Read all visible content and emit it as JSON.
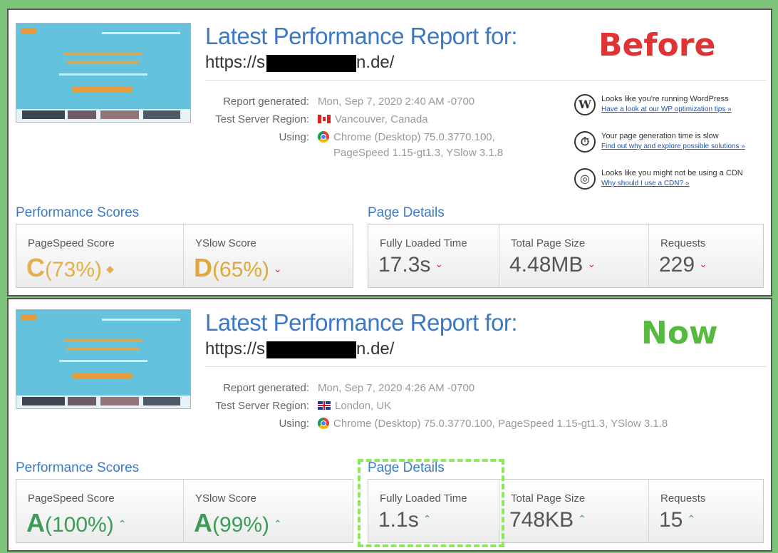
{
  "colors": {
    "background": "#7dc47a",
    "title": "#3d79c2",
    "before_badge": "#e03434",
    "now_badge": "#55bb3f",
    "grade_c": "#e3b04a",
    "grade_d": "#e0a83a",
    "grade_a": "#3a9d57",
    "down_arrow": "#d62d3b",
    "up_arrow": "#3a9d57",
    "highlight_border": "#8ee85d"
  },
  "reports": [
    {
      "badge": "Before",
      "title": "Latest Performance Report for:",
      "url_prefix": "https://s",
      "url_suffix": "n.de/",
      "report_generated_label": "Report generated:",
      "report_generated_value": "Mon, Sep 7, 2020 2:40 AM -0700",
      "region_label": "Test Server Region:",
      "region_value": "Vancouver, Canada",
      "region_flag": "canada-flag-icon",
      "using_label": "Using:",
      "using_value_1": "Chrome (Desktop) 75.0.3770.100,",
      "using_value_2": "PageSpeed 1.15-gt1.3, YSlow 3.1.8",
      "tips": [
        {
          "icon": "wordpress-icon",
          "glyph": "W",
          "text": "Looks like you're running WordPress",
          "link": "Have a look at our WP optimization tips »"
        },
        {
          "icon": "stopwatch-icon",
          "glyph": "⏱",
          "text": "Your page generation time is slow",
          "link": "Find out why and explore possible solutions »"
        },
        {
          "icon": "globe-icon",
          "glyph": "◎",
          "text": "Looks like you might not be using a CDN",
          "link": "Why should I use a CDN? »"
        }
      ],
      "performance_title": "Performance Scores",
      "page_details_title": "Page Details",
      "pagespeed_label": "PageSpeed Score",
      "pagespeed_grade": "C",
      "pagespeed_value": "(73%)",
      "pagespeed_arrow": "◆",
      "yslow_label": "YSlow Score",
      "yslow_grade": "D",
      "yslow_value": "(65%)",
      "yslow_arrow": "⌄",
      "fully_loaded_label": "Fully Loaded Time",
      "fully_loaded_value": "17.3s",
      "page_size_label": "Total Page Size",
      "page_size_value": "4.48MB",
      "requests_label": "Requests",
      "requests_value": "229",
      "detail_arrow": "⌄"
    },
    {
      "badge": "Now",
      "title": "Latest Performance Report for:",
      "url_prefix": "https://s",
      "url_suffix": "n.de/",
      "report_generated_label": "Report generated:",
      "report_generated_value": "Mon, Sep 7, 2020 4:26 AM -0700",
      "region_label": "Test Server Region:",
      "region_value": "London, UK",
      "region_flag": "uk-flag-icon",
      "using_label": "Using:",
      "using_value_1": "Chrome (Desktop) 75.0.3770.100, PageSpeed 1.15-gt1.3, YSlow 3.1.8",
      "performance_title": "Performance Scores",
      "page_details_title": "Page Details",
      "pagespeed_label": "PageSpeed Score",
      "pagespeed_grade": "A",
      "pagespeed_value": "(100%)",
      "pagespeed_arrow": "⌃",
      "yslow_label": "YSlow Score",
      "yslow_grade": "A",
      "yslow_value": "(99%)",
      "yslow_arrow": "⌃",
      "fully_loaded_label": "Fully Loaded Time",
      "fully_loaded_value": "1.1s",
      "page_size_label": "Total Page Size",
      "page_size_value": "748KB",
      "requests_label": "Requests",
      "requests_value": "15",
      "detail_arrow": "⌃"
    }
  ]
}
